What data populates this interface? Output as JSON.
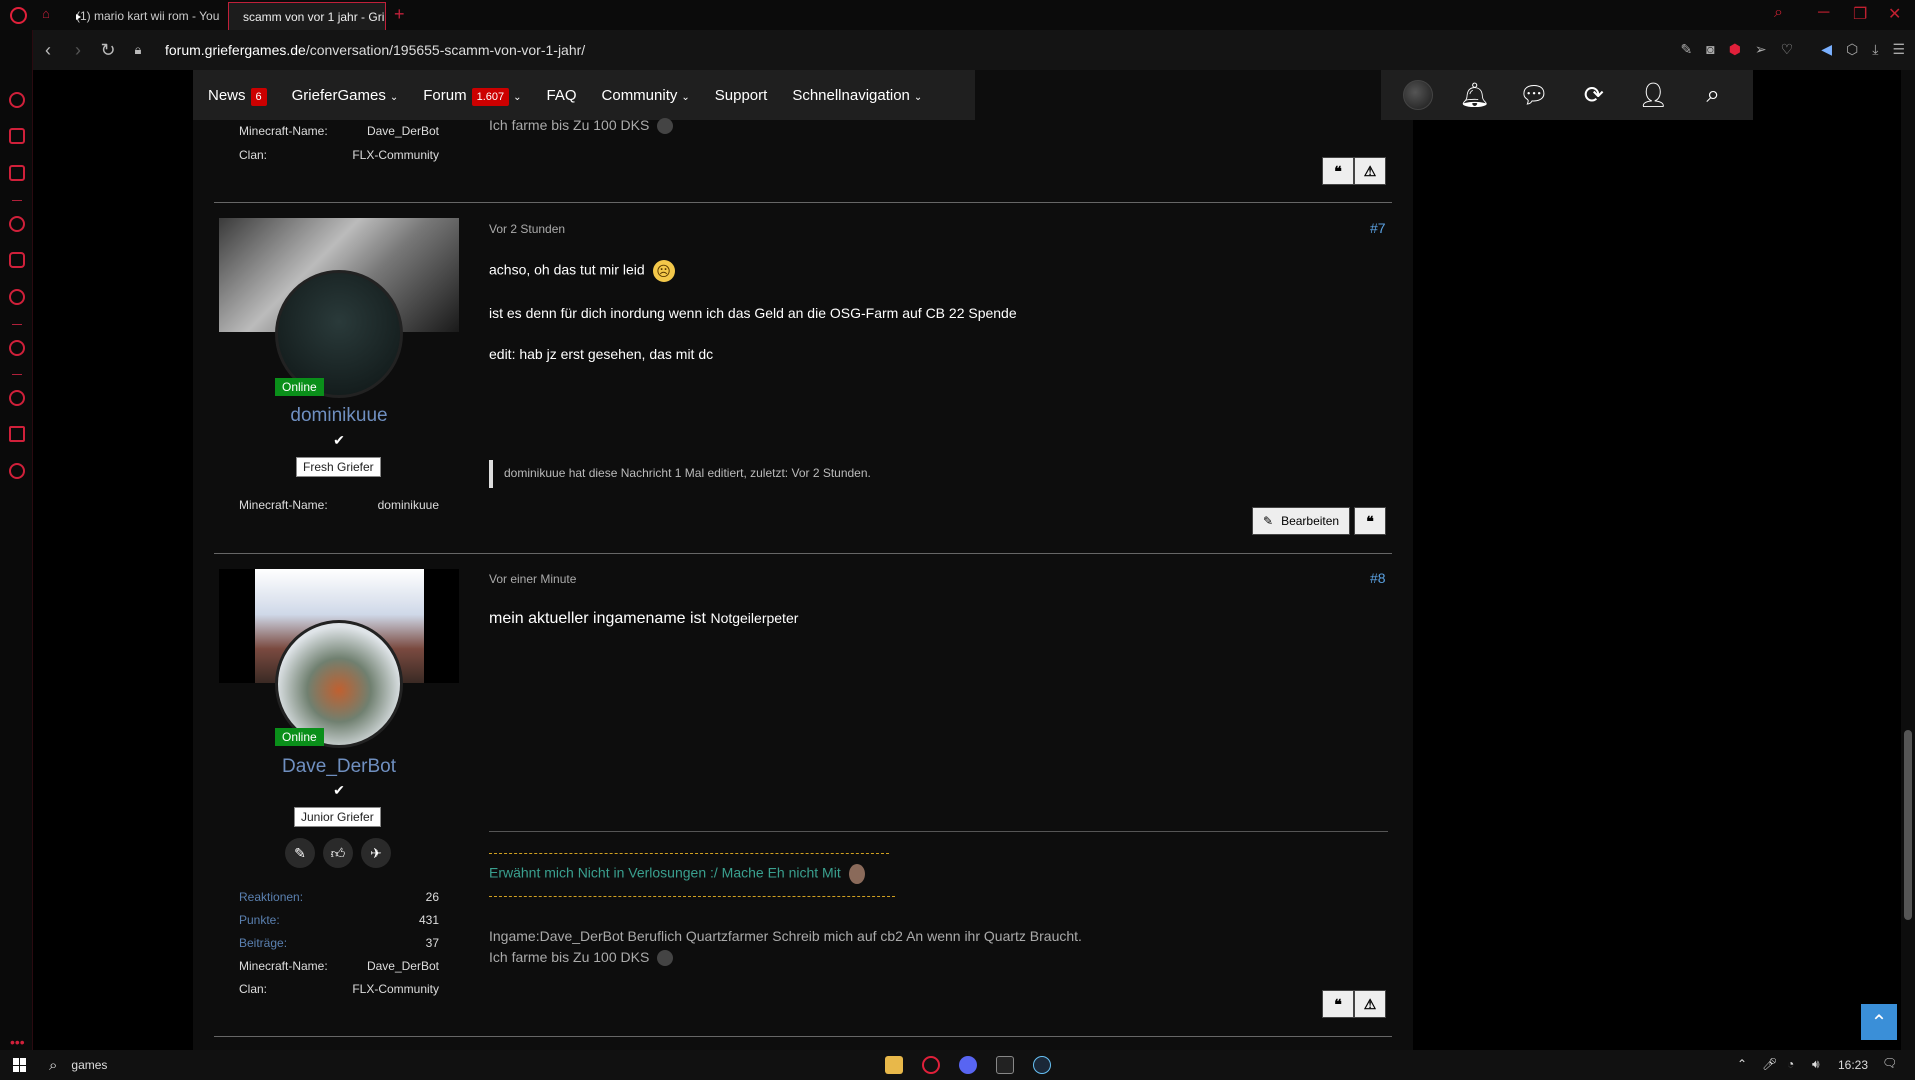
{
  "browser": {
    "tabs": [
      {
        "title": "(1) mario kart wii rom - You",
        "active": false
      },
      {
        "title": "scamm von vor 1 jahr - Gri",
        "active": true
      }
    ],
    "new_tab": "+",
    "url_host": "forum.griefergames.de",
    "url_path": "/conversation/195655-scamm-von-vor-1-jahr/"
  },
  "site_nav": {
    "items": [
      {
        "label": "News",
        "badge": "6",
        "caret": false
      },
      {
        "label": "GrieferGames",
        "badge": "",
        "caret": true
      },
      {
        "label": "Forum",
        "badge": "1.607",
        "caret": true
      },
      {
        "label": "FAQ",
        "badge": "",
        "caret": false
      },
      {
        "label": "Community",
        "badge": "",
        "caret": true
      },
      {
        "label": "Support",
        "badge": "",
        "caret": false
      },
      {
        "label": "Schnellnavigation",
        "badge": "",
        "caret": true
      }
    ]
  },
  "prev_post": {
    "meta": [
      {
        "label": "Minecraft-Name:",
        "value": "Dave_DerBot"
      },
      {
        "label": "Clan:",
        "value": "FLX-Community"
      }
    ],
    "sig_line": "Ich farme bis Zu 100 DKS"
  },
  "post7": {
    "time": "Vor 2 Stunden",
    "number": "#7",
    "lines": [
      "achso, oh das tut mir leid",
      "ist es denn für dich inordung wenn ich das Geld an die OSG-Farm auf CB 22 Spende",
      "edit: hab jz erst gesehen, das mit dc"
    ],
    "edit_note": "dominikuue hat diese Nachricht 1 Mal editiert, zuletzt: Vor 2 Stunden.",
    "online": "Online",
    "username": "dominikuue",
    "rank": "Fresh Griefer",
    "meta": [
      {
        "label": "Minecraft-Name:",
        "value": "dominikuue"
      }
    ],
    "edit_button": "Bearbeiten"
  },
  "post8": {
    "time": "Vor einer Minute",
    "number": "#8",
    "text_main": "mein aktueller ingamename ist",
    "text_name": "Notgeilerpeter",
    "online": "Online",
    "username": "Dave_DerBot",
    "rank": "Junior Griefer",
    "stats": [
      {
        "label": "Reaktionen:",
        "value": "26"
      },
      {
        "label": "Punkte:",
        "value": "431"
      },
      {
        "label": "Beiträge:",
        "value": "37"
      }
    ],
    "meta": [
      {
        "label": "Minecraft-Name:",
        "value": "Dave_DerBot"
      },
      {
        "label": "Clan:",
        "value": "FLX-Community"
      }
    ],
    "sig_link": "Erwähnt mich Nicht in Verlosungen :/ Mache Eh nicht Mit",
    "sig_line1": "Ingame:Dave_DerBot Beruflich Quartzfarmer Schreib mich auf cb2 An wenn ihr Quartz Braucht.",
    "sig_line2": "Ich farme bis Zu 100 DKS"
  },
  "taskbar": {
    "search": "games",
    "time": "16:23"
  },
  "colors": {
    "accent_red": "#c00000",
    "online_green": "#0a8f1a",
    "username_blue": "#6f8fc0",
    "scroll_top": "#3a8fd8"
  }
}
